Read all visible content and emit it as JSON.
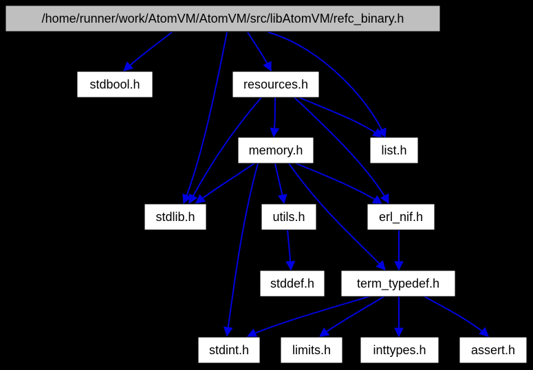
{
  "chart_data": {
    "type": "diagram",
    "description": "Include dependency graph for refc_binary.h",
    "nodes": [
      {
        "id": "root",
        "label": "/home/runner/work/AtomVM/AtomVM/src/libAtomVM/refc_binary.h"
      },
      {
        "id": "stdbool",
        "label": "stdbool.h"
      },
      {
        "id": "resources",
        "label": "resources.h"
      },
      {
        "id": "memory",
        "label": "memory.h"
      },
      {
        "id": "list",
        "label": "list.h"
      },
      {
        "id": "stdlib",
        "label": "stdlib.h"
      },
      {
        "id": "utils",
        "label": "utils.h"
      },
      {
        "id": "erl_nif",
        "label": "erl_nif.h"
      },
      {
        "id": "stddef",
        "label": "stddef.h"
      },
      {
        "id": "term_typedef",
        "label": "term_typedef.h"
      },
      {
        "id": "stdint",
        "label": "stdint.h"
      },
      {
        "id": "limits",
        "label": "limits.h"
      },
      {
        "id": "inttypes",
        "label": "inttypes.h"
      },
      {
        "id": "assert",
        "label": "assert.h"
      }
    ],
    "edges": [
      {
        "from": "root",
        "to": "stdbool"
      },
      {
        "from": "root",
        "to": "stdlib"
      },
      {
        "from": "root",
        "to": "resources"
      },
      {
        "from": "root",
        "to": "list"
      },
      {
        "from": "resources",
        "to": "stdlib"
      },
      {
        "from": "resources",
        "to": "memory"
      },
      {
        "from": "resources",
        "to": "erl_nif"
      },
      {
        "from": "resources",
        "to": "list"
      },
      {
        "from": "memory",
        "to": "stdlib"
      },
      {
        "from": "memory",
        "to": "stdint"
      },
      {
        "from": "memory",
        "to": "utils"
      },
      {
        "from": "memory",
        "to": "erl_nif"
      },
      {
        "from": "memory",
        "to": "term_typedef"
      },
      {
        "from": "utils",
        "to": "stddef"
      },
      {
        "from": "erl_nif",
        "to": "term_typedef"
      },
      {
        "from": "term_typedef",
        "to": "stdint"
      },
      {
        "from": "term_typedef",
        "to": "limits"
      },
      {
        "from": "term_typedef",
        "to": "inttypes"
      },
      {
        "from": "term_typedef",
        "to": "assert"
      }
    ]
  },
  "nodes": {
    "root": "/home/runner/work/AtomVM/AtomVM/src/libAtomVM/refc_binary.h",
    "stdbool": "stdbool.h",
    "resources": "resources.h",
    "memory": "memory.h",
    "list": "list.h",
    "stdlib": "stdlib.h",
    "utils": "utils.h",
    "erl_nif": "erl_nif.h",
    "stddef": "stddef.h",
    "term_typedef": "term_typedef.h",
    "stdint": "stdint.h",
    "limits": "limits.h",
    "inttypes": "inttypes.h",
    "assert": "assert.h"
  }
}
